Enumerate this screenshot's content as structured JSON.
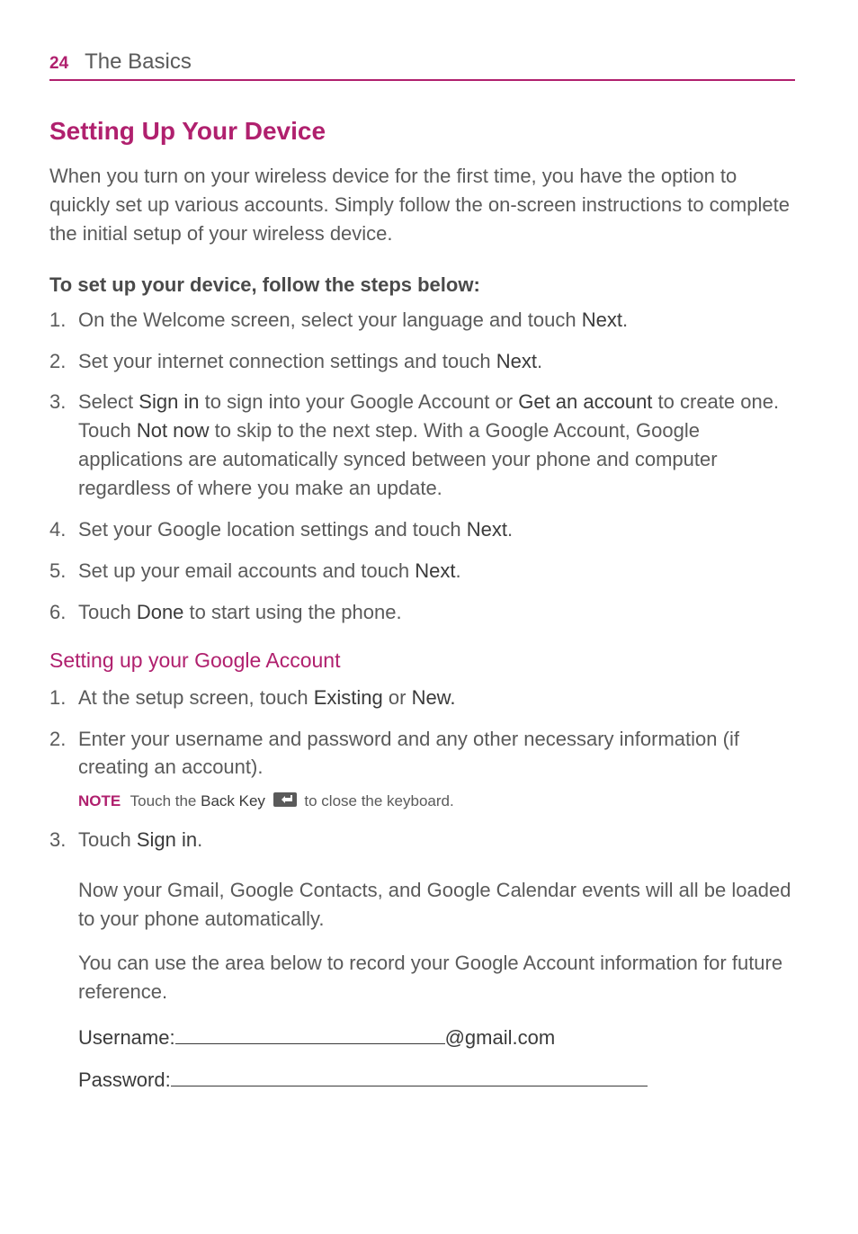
{
  "header": {
    "page_number": "24",
    "section": "The Basics"
  },
  "title": "Setting Up Your Device",
  "intro": "When you turn on your wireless device for the first time, you have the option to quickly set up various accounts. Simply follow the on-screen instructions to complete the initial setup of your wireless device.",
  "steps_heading": "To set up your device, follow the steps below:",
  "steps": {
    "s1_a": "On the Welcome screen, select your language and touch ",
    "s1_b": "Next",
    "s1_c": ".",
    "s2_a": "Set your internet connection settings and touch ",
    "s2_b": "Next",
    "s2_c": ".",
    "s3_a": "Select ",
    "s3_b": "Sign in",
    "s3_c": " to sign into your Google Account or ",
    "s3_d": "Get an account",
    "s3_e": " to create one. Touch ",
    "s3_f": "Not now",
    "s3_g": " to skip to the next step. With a Google Account, Google applications are automatically synced between your phone and computer regardless of where you make an update.",
    "s4_a": "Set your Google location settings and touch ",
    "s4_b": "Next",
    "s4_c": ".",
    "s5_a": "Set up your email accounts and touch ",
    "s5_b": "Next",
    "s5_c": ".",
    "s6_a": "Touch ",
    "s6_b": "Done",
    "s6_c": " to start using the phone."
  },
  "google_heading": "Setting up your Google Account",
  "gsteps": {
    "g1_a": "At the setup screen, touch ",
    "g1_b": "Existing",
    "g1_c": " or ",
    "g1_d": "New.",
    "g2": "Enter your username and password and any other necessary information (if creating an account).",
    "note_label": "NOTE",
    "note_a": "Touch the ",
    "note_b": "Back Key",
    "note_c": " to close the keyboard.",
    "g3_a": "Touch ",
    "g3_b": "Sign in",
    "g3_c": "."
  },
  "after": {
    "p1": "Now your Gmail, Google Contacts, and Google Calendar events will all be loaded to your phone automatically.",
    "p2": "You can use the area below to record your Google Account information for future reference.",
    "username_label": "Username:",
    "domain": "@gmail.com",
    "password_label": "Password:"
  }
}
